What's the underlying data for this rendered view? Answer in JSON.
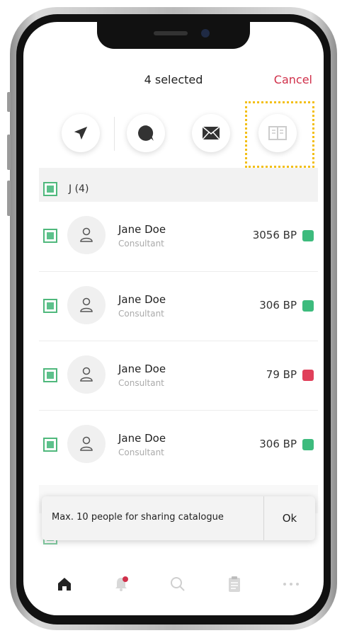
{
  "header": {
    "title": "4 selected",
    "cancel_label": "Cancel"
  },
  "actions": [
    {
      "icon": "send-icon"
    },
    {
      "icon": "chat-bubble-icon"
    },
    {
      "icon": "mail-icon"
    },
    {
      "icon": "catalogue-book-icon"
    }
  ],
  "group": {
    "label": "J (4)"
  },
  "contacts": [
    {
      "name": "Jane Doe",
      "role": "Consultant",
      "points": "3056 BP",
      "trend": "up"
    },
    {
      "name": "Jane Doe",
      "role": "Consultant",
      "points": "306 BP",
      "trend": "up"
    },
    {
      "name": "Jane Doe",
      "role": "Consultant",
      "points": "79 BP",
      "trend": "down"
    },
    {
      "name": "Jane Doe",
      "role": "Consultant",
      "points": "306 BP",
      "trend": "up"
    }
  ],
  "toast": {
    "message": "Max. 10 people for sharing catalogue",
    "ok_label": "Ok"
  },
  "tabbar": [
    {
      "icon": "home-icon"
    },
    {
      "icon": "bell-icon"
    },
    {
      "icon": "search-icon"
    },
    {
      "icon": "clipboard-icon"
    },
    {
      "icon": "more-icon"
    }
  ],
  "colors": {
    "accent": "#d0304a",
    "check": "#5cc18b",
    "up": "#3dbb7d",
    "down": "#e0405a",
    "highlight": "#f3bf16"
  }
}
